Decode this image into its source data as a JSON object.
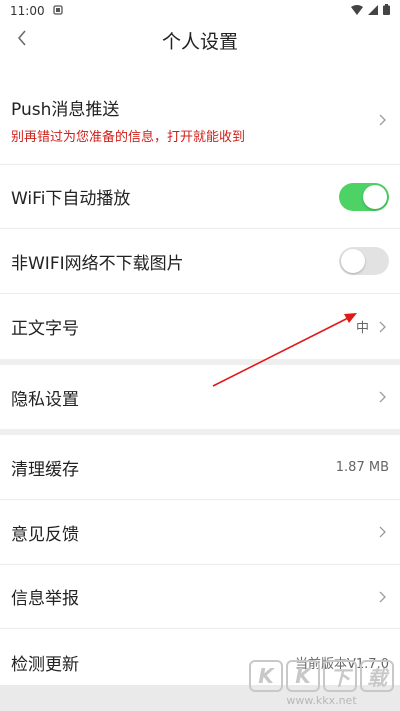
{
  "status": {
    "time": "11:00"
  },
  "header": {
    "title": "个人设置"
  },
  "settings": {
    "push": {
      "label": "Push消息推送",
      "subtitle": "别再错过为您准备的信息，打开就能收到"
    },
    "wifi_autoplay": {
      "label": "WiFi下自动播放",
      "enabled": true
    },
    "no_image": {
      "label": "非WIFI网络不下载图片",
      "enabled": false
    },
    "font_size": {
      "label": "正文字号",
      "value": "中"
    },
    "privacy": {
      "label": "隐私设置"
    },
    "cache": {
      "label": "清理缓存",
      "value": "1.87 MB"
    },
    "feedback": {
      "label": "意见反馈"
    },
    "report": {
      "label": "信息举报"
    },
    "update": {
      "label": "检测更新",
      "value": "当前版本V1.7.0"
    }
  },
  "watermark": {
    "logo_text": [
      "K",
      "K",
      "下",
      "载"
    ],
    "url": "www.kkx.net"
  },
  "colors": {
    "toggle_on": "#4cd265",
    "toggle_off": "#e2e2e2",
    "warning_text": "#d0201a",
    "annotation_arrow": "#e01818"
  }
}
